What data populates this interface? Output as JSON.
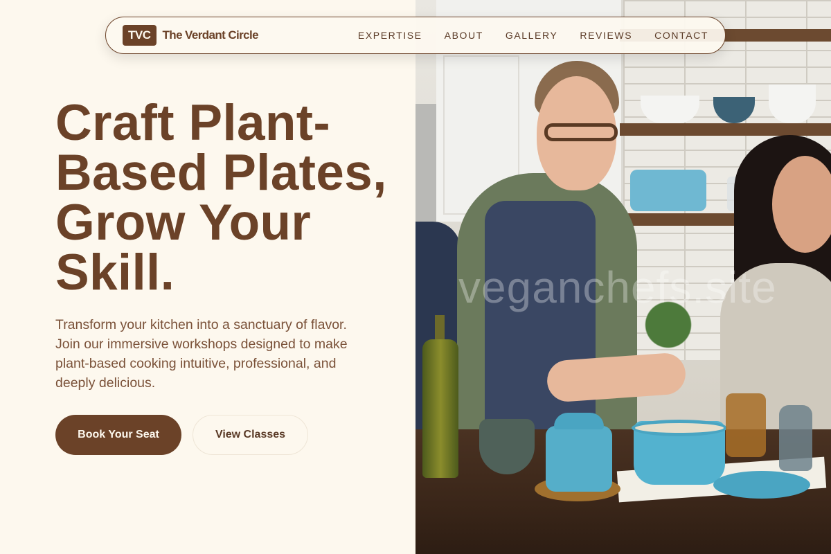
{
  "brand": {
    "badge": "TVC",
    "name": "The Verdant Circle"
  },
  "nav": {
    "links": [
      "EXPERTISE",
      "ABOUT",
      "GALLERY",
      "REVIEWS",
      "CONTACT"
    ]
  },
  "hero": {
    "title": "Craft Plant-Based Plates, Grow Your Skill.",
    "subtitle": "Transform your kitchen into a sanctuary of flavor. Join our immersive workshops designed to make plant-based cooking intuitive, professional, and deeply delicious.",
    "primary_cta": "Book Your Seat",
    "secondary_cta": "View Classes"
  },
  "photo": {
    "watermark": "veganchefs.site"
  },
  "colors": {
    "brand_brown": "#6b4228",
    "background_cream": "#fdf8ee"
  }
}
